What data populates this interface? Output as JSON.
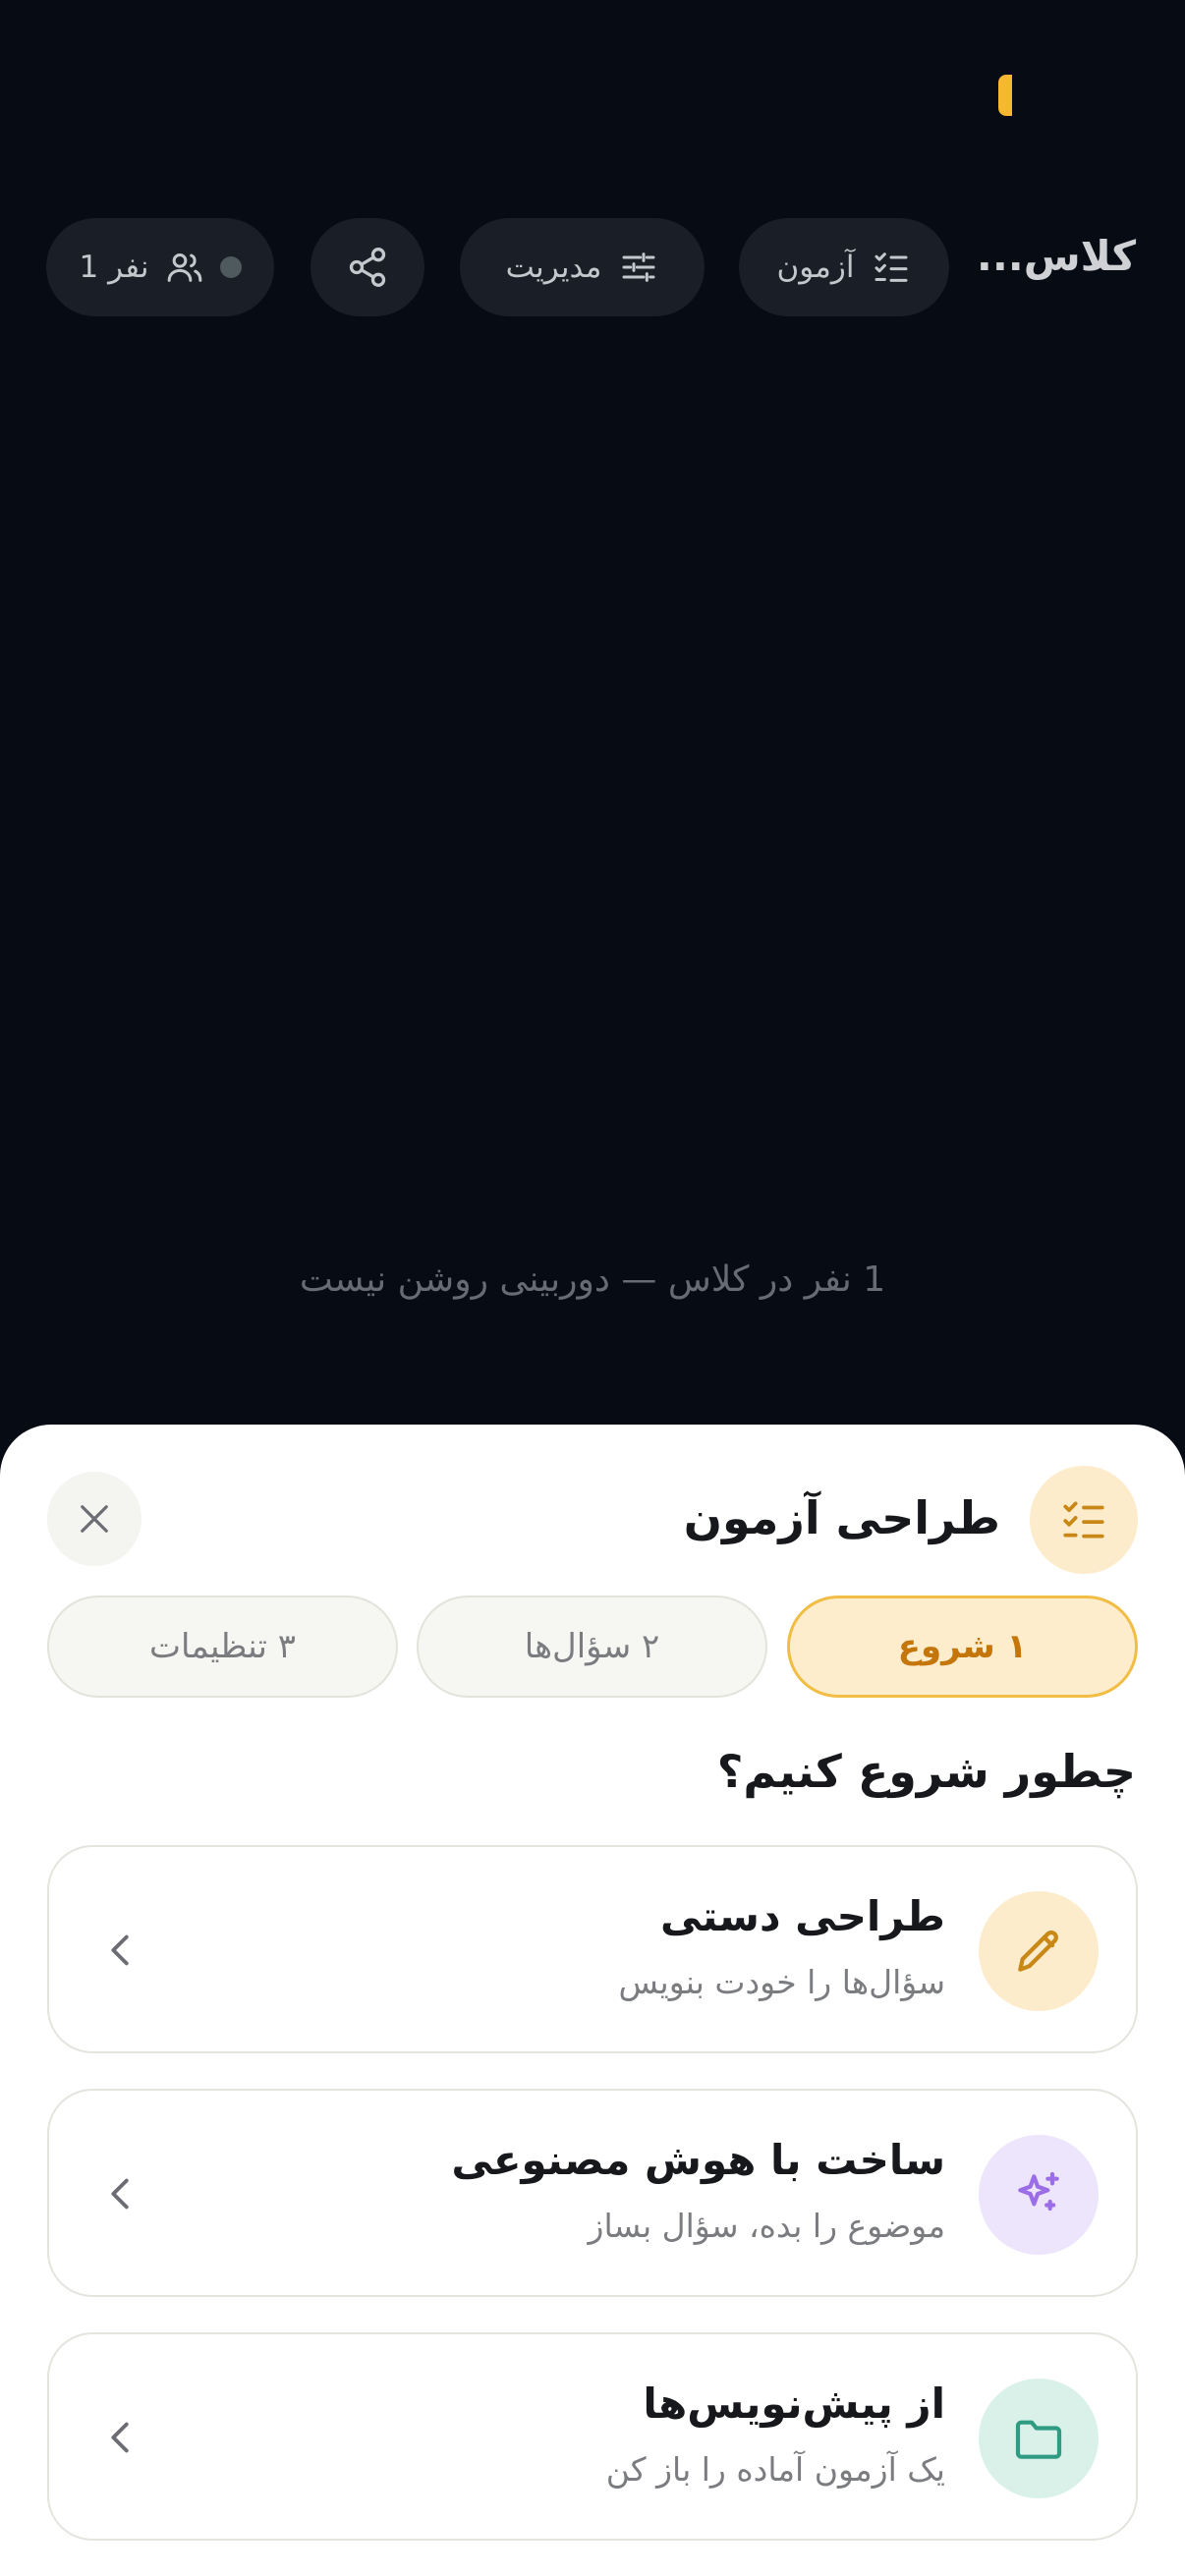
{
  "header": {
    "room_title": "کلاس...",
    "exam_chip_label": "آزمون",
    "manage_chip_label": "مدیریت",
    "participants_label": "1 نفر"
  },
  "stage": {
    "status_text": "1 نفر در کلاس — دوربینی روشن نیست"
  },
  "sheet": {
    "title": "طراحی آزمون",
    "steps": [
      {
        "label": "۱ شروع",
        "active": true
      },
      {
        "label": "۲ سؤال‌ها",
        "active": false
      },
      {
        "label": "۳ تنظیمات",
        "active": false
      }
    ],
    "question": "چطور شروع کنیم؟",
    "options": [
      {
        "title": "طراحی دستی",
        "subtitle": "سؤال‌ها را خودت بنویس",
        "icon": "pencil-icon"
      },
      {
        "title": "ساخت با هوش مصنوعی",
        "subtitle": "موضوع را بده، سؤال بساز",
        "icon": "sparkles-icon"
      },
      {
        "title": "از پیش‌نویس‌ها",
        "subtitle": "یک آزمون آماده را باز کن",
        "icon": "folder-icon"
      }
    ]
  },
  "colors": {
    "background": "#070b14",
    "accent": "#f5b82e",
    "accent_text": "#c4760a",
    "ai_purple": "#9b6ee8",
    "draft_teal": "#2e9b82"
  }
}
